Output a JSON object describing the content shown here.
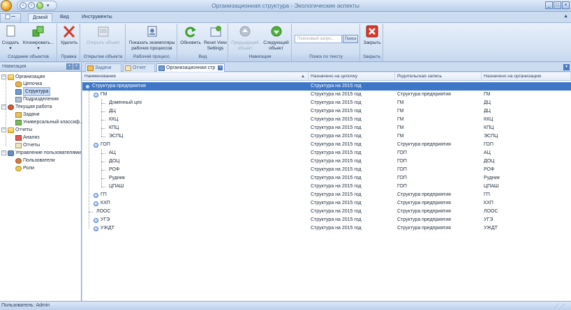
{
  "window": {
    "title": "Организационная структура - Экологические аспекты",
    "controls": [
      "_",
      "□",
      "×"
    ]
  },
  "ribbon_tabs": {
    "file": "",
    "items": [
      "Домой",
      "Вид",
      "Инструменты"
    ],
    "active": "Домой"
  },
  "ribbon": {
    "groups": [
      {
        "label": "Создание объектов",
        "buttons": [
          {
            "label": "Создать",
            "icon": "new-document-icon",
            "enabled": true,
            "dropdown": true
          },
          {
            "label": "Клонировать...",
            "icon": "clone-icon",
            "enabled": true,
            "dropdown": true
          }
        ]
      },
      {
        "label": "Правка",
        "buttons": [
          {
            "label": "Удалить",
            "icon": "delete-icon",
            "enabled": true
          }
        ]
      },
      {
        "label": "Открытие объекта",
        "buttons": [
          {
            "label": "Открыть объект",
            "icon": "open-object-icon",
            "enabled": false
          }
        ]
      },
      {
        "label": "Рабочий процесс",
        "buttons": [
          {
            "label": "Показать экземпляры рабочих процессов",
            "icon": "workflow-instances-icon",
            "enabled": true
          }
        ]
      },
      {
        "label": "Вид",
        "buttons": [
          {
            "label": "Обновить",
            "icon": "refresh-icon",
            "enabled": true
          },
          {
            "label": "Reset View Settings",
            "icon": "reset-view-icon",
            "enabled": true
          }
        ]
      },
      {
        "label": "Навигация",
        "buttons": [
          {
            "label": "Предыдущий объект",
            "icon": "previous-icon",
            "enabled": false
          },
          {
            "label": "Следующий объект",
            "icon": "next-icon",
            "enabled": true
          }
        ]
      },
      {
        "label": "Поиск по тексту",
        "search": {
          "placeholder": "Поисковый запро...",
          "button": "Поиск"
        }
      },
      {
        "label": "Закрыть",
        "buttons": [
          {
            "label": "Закрыть",
            "icon": "close-icon",
            "enabled": true
          }
        ]
      }
    ]
  },
  "navigation": {
    "title": "Навигация",
    "items": [
      {
        "label": "Организация",
        "icon": "folder-icon",
        "level": 0,
        "expanded": true
      },
      {
        "label": "Цепочка",
        "icon": "chain-icon",
        "level": 1
      },
      {
        "label": "Структура",
        "icon": "structure-icon",
        "level": 1,
        "selected": true
      },
      {
        "label": "Подразделения",
        "icon": "department-icon",
        "level": 1
      },
      {
        "label": "Текущая работа",
        "icon": "current-work-icon",
        "level": 0,
        "expanded": true
      },
      {
        "label": "Задачи",
        "icon": "task-icon",
        "level": 1
      },
      {
        "label": "Универсальный классиф...",
        "icon": "classifier-icon",
        "level": 1
      },
      {
        "label": "Отчеты",
        "icon": "folder-icon",
        "level": 0,
        "expanded": true
      },
      {
        "label": "Анализ",
        "icon": "analysis-icon",
        "level": 1
      },
      {
        "label": "Отчеты",
        "icon": "report-icon",
        "level": 1
      },
      {
        "label": "Управление пользователями",
        "icon": "users-folder-icon",
        "level": 0,
        "expanded": true
      },
      {
        "label": "Пользователи",
        "icon": "user-icon",
        "level": 1
      },
      {
        "label": "Роли",
        "icon": "role-icon",
        "level": 1
      }
    ]
  },
  "doc_tabs": [
    {
      "label": "Задачи",
      "icon": "task-icon",
      "active": false
    },
    {
      "label": "Отчет",
      "icon": "report-icon",
      "active": false
    },
    {
      "label": "Организационная стр",
      "icon": "structure-icon",
      "active": true
    }
  ],
  "grid": {
    "columns": [
      "Наименование",
      "Назначено на цепочку",
      "Родительская запись",
      "Назначено на организацию"
    ],
    "sort_column": "Наименование",
    "rows": [
      {
        "name": "Структура предприятия",
        "level": 0,
        "expander": true,
        "chain": "Структура на 2015 год",
        "parent": "",
        "org": "",
        "selected": true
      },
      {
        "name": "ГМ",
        "level": 1,
        "expander": true,
        "chain": "Структура на 2015 год",
        "parent": "Структура предприятия",
        "org": "ГМ"
      },
      {
        "name": "Доменный цех",
        "level": 2,
        "expander": false,
        "chain": "Структура на 2015 год",
        "parent": "ГМ",
        "org": "ДЦ"
      },
      {
        "name": "ДЦ",
        "level": 2,
        "expander": false,
        "chain": "Структура на 2015 год",
        "parent": "ГМ",
        "org": "ДЦ"
      },
      {
        "name": "ККЦ",
        "level": 2,
        "expander": false,
        "chain": "Структура на 2015 год",
        "parent": "ГМ",
        "org": "ККЦ"
      },
      {
        "name": "КПЦ",
        "level": 2,
        "expander": false,
        "chain": "Структура на 2015 год",
        "parent": "ГМ",
        "org": "КПЦ"
      },
      {
        "name": "ЭСПЦ",
        "level": 2,
        "expander": false,
        "chain": "Структура на 2015 год",
        "parent": "ГМ",
        "org": "ЭСПЦ"
      },
      {
        "name": "ГОП",
        "level": 1,
        "expander": true,
        "chain": "Структура на 2015 год",
        "parent": "Структура предприятия",
        "org": "ГОП"
      },
      {
        "name": "АЦ",
        "level": 2,
        "expander": false,
        "chain": "Структура на 2015 год",
        "parent": "ГОП",
        "org": "АЦ"
      },
      {
        "name": "ДОЦ",
        "level": 2,
        "expander": false,
        "chain": "Структура на 2015 год",
        "parent": "ГОП",
        "org": "ДОЦ"
      },
      {
        "name": "РОФ",
        "level": 2,
        "expander": false,
        "chain": "Структура на 2015 год",
        "parent": "ГОП",
        "org": "РОФ"
      },
      {
        "name": "Рудник",
        "level": 2,
        "expander": false,
        "chain": "Структура на 2015 год",
        "parent": "ГОП",
        "org": "Рудник"
      },
      {
        "name": "ЦПАШ",
        "level": 2,
        "expander": false,
        "chain": "Структура на 2015 год",
        "parent": "ГОП",
        "org": "ЦПАШ"
      },
      {
        "name": "ГП",
        "level": 1,
        "expander": true,
        "chain": "Структура на 2015 год",
        "parent": "Структура предприятия",
        "org": "ГП"
      },
      {
        "name": "КХП",
        "level": 1,
        "expander": true,
        "chain": "Структура на 2015 год",
        "parent": "Структура предприятия",
        "org": "КХП"
      },
      {
        "name": "ЛООС",
        "level": 1,
        "expander": false,
        "chain": "Структура на 2015 год",
        "parent": "Структура предприятия",
        "org": "ЛООС"
      },
      {
        "name": "УГЭ",
        "level": 1,
        "expander": true,
        "chain": "Структура на 2015 год",
        "parent": "Структура предприятия",
        "org": "УГЭ"
      },
      {
        "name": "УЖДТ",
        "level": 1,
        "expander": true,
        "chain": "Структура на 2015 год",
        "parent": "Структура предприятия",
        "org": "УЖДТ"
      }
    ]
  },
  "status": {
    "user": "Пользователь: Admin"
  },
  "colors": {
    "selection": "#3f77c8",
    "ribbon": "#d3e1f3",
    "frame": "#8ea9cf"
  }
}
